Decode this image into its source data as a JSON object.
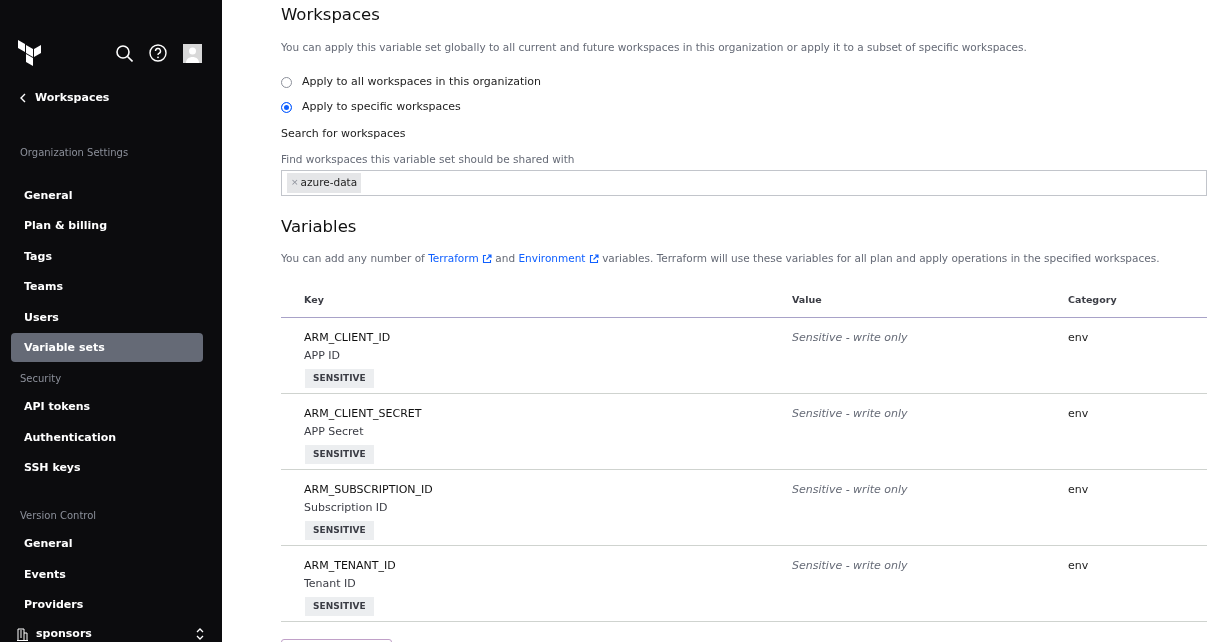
{
  "sidebar": {
    "back_link": "Workspaces",
    "sections": [
      {
        "title": "Organization Settings",
        "items": [
          {
            "label": "General",
            "selected": false
          },
          {
            "label": "Plan & billing",
            "selected": false
          },
          {
            "label": "Tags",
            "selected": false
          },
          {
            "label": "Teams",
            "selected": false
          },
          {
            "label": "Users",
            "selected": false
          },
          {
            "label": "Variable sets",
            "selected": true
          }
        ]
      },
      {
        "title": "Security",
        "items": [
          {
            "label": "API tokens",
            "selected": false
          },
          {
            "label": "Authentication",
            "selected": false
          },
          {
            "label": "SSH keys",
            "selected": false
          }
        ]
      },
      {
        "title": "Version Control",
        "items": [
          {
            "label": "General",
            "selected": false
          },
          {
            "label": "Events",
            "selected": false
          },
          {
            "label": "Providers",
            "selected": false
          }
        ]
      }
    ],
    "org_switcher": "sponsors"
  },
  "workspaces": {
    "title": "Workspaces",
    "description": "You can apply this variable set globally to all current and future workspaces in this organization or apply it to a subset of specific workspaces.",
    "options": [
      {
        "label": "Apply to all workspaces in this organization",
        "selected": false
      },
      {
        "label": "Apply to specific workspaces",
        "selected": true
      }
    ],
    "search": {
      "label": "Search for workspaces",
      "hint": "Find workspaces this variable set should be shared with",
      "tags": [
        {
          "remove": "×",
          "label": "azure-data"
        }
      ]
    }
  },
  "variables": {
    "title": "Variables",
    "description": [
      {
        "kind": "text",
        "text": "You can add any number of "
      },
      {
        "kind": "link",
        "text": "Terraform"
      },
      {
        "kind": "text",
        "text": " and "
      },
      {
        "kind": "link",
        "text": "Environment"
      },
      {
        "kind": "text",
        "text": " variables. Terraform will use these variables for all plan and apply operations in the specified workspaces."
      }
    ],
    "table": {
      "columns": [
        "Key",
        "Value",
        "Category"
      ],
      "rows": [
        {
          "key": "ARM_CLIENT_ID",
          "description": "APP ID",
          "badge": "SENSITIVE",
          "value": "Sensitive - write only",
          "category": "env"
        },
        {
          "key": "ARM_CLIENT_SECRET",
          "description": "APP Secret",
          "badge": "SENSITIVE",
          "value": "Sensitive - write only",
          "category": "env"
        },
        {
          "key": "ARM_SUBSCRIPTION_ID",
          "description": "Subscription ID",
          "badge": "SENSITIVE",
          "value": "Sensitive - write only",
          "category": "env"
        },
        {
          "key": "ARM_TENANT_ID",
          "description": "Tenant ID",
          "badge": "SENSITIVE",
          "value": "Sensitive - write only",
          "category": "env"
        }
      ]
    }
  }
}
